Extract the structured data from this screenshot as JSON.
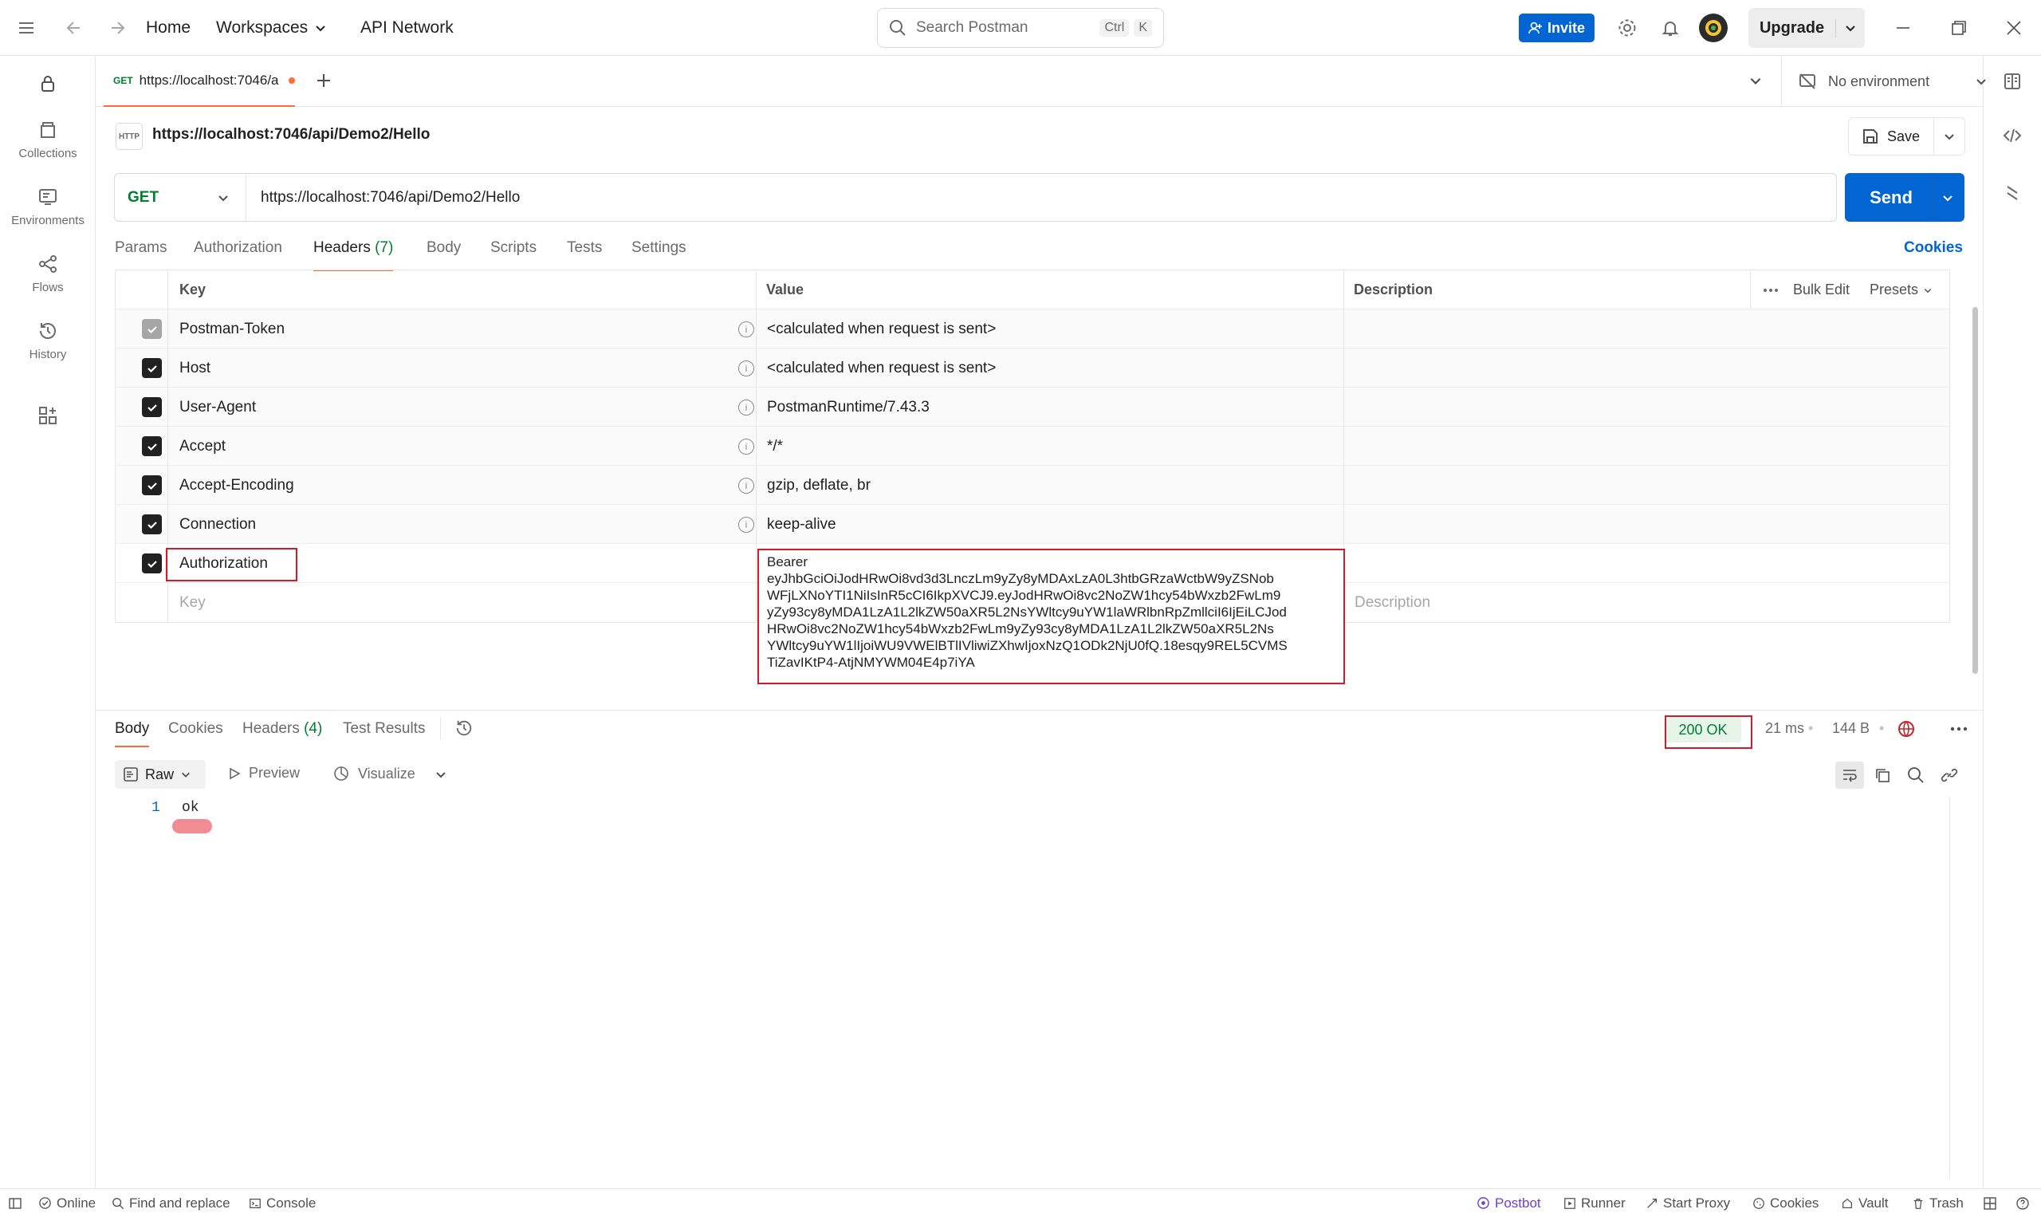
{
  "topbar": {
    "home": "Home",
    "workspaces": "Workspaces",
    "api_network": "API Network",
    "search_placeholder": "Search Postman",
    "kbd_ctrl": "Ctrl",
    "kbd_k": "K",
    "invite": "Invite",
    "upgrade": "Upgrade"
  },
  "sidebar": {
    "items": [
      {
        "label": "Collections",
        "icon": "collections-icon"
      },
      {
        "label": "Environments",
        "icon": "environments-icon"
      },
      {
        "label": "Flows",
        "icon": "flows-icon"
      },
      {
        "label": "History",
        "icon": "history-icon"
      }
    ]
  },
  "tabs": {
    "active_method": "GET",
    "active_label": "https://localhost:7046/a",
    "environment": "No environment"
  },
  "request": {
    "title": "https://localhost:7046/api/Demo2/Hello",
    "save": "Save",
    "method": "GET",
    "url": "https://localhost:7046/api/Demo2/Hello",
    "send": "Send",
    "tabs": [
      "Params",
      "Authorization",
      "Headers",
      "Body",
      "Scripts",
      "Tests",
      "Settings"
    ],
    "headers_count": "(7)",
    "cookies": "Cookies"
  },
  "headers_table": {
    "col_key": "Key",
    "col_value": "Value",
    "col_description": "Description",
    "bulk_edit": "Bulk Edit",
    "presets": "Presets",
    "rows": [
      {
        "key": "Postman-Token",
        "value": "<calculated when request is sent>",
        "checked": "disabled"
      },
      {
        "key": "Host",
        "value": "<calculated when request is sent>",
        "checked": "true"
      },
      {
        "key": "User-Agent",
        "value": "PostmanRuntime/7.43.3",
        "checked": "true"
      },
      {
        "key": "Accept",
        "value": "*/*",
        "checked": "true"
      },
      {
        "key": "Accept-Encoding",
        "value": "gzip, deflate, br",
        "checked": "true"
      },
      {
        "key": "Connection",
        "value": "keep-alive",
        "checked": "true"
      }
    ],
    "auth_key": "Authorization",
    "auth_value_lines": [
      "Bearer",
      "eyJhbGciOiJodHRwOi8vd3d3LnczLm9yZy8yMDAxLzA0L3htbGRzaWctbW9yZSNob",
      "WFjLXNoYTI1NiIsInR5cCI6IkpXVCJ9.eyJodHRwOi8vc2NoZW1hcy54bWxzb2FwLm9",
      "yZy93cy8yMDA1LzA1L2lkZW50aXR5L2NsYWltcy9uYW1laWRlbnRpZmllciI6IjEiLCJod",
      "HRwOi8vc2NoZW1hcy54bWxzb2FwLm9yZy93cy8yMDA1LzA1L2lkZW50aXR5L2Ns",
      "YWltcy9uYW1lIjoiWU9VWElBTlIVliwiZXhwIjoxNzQ1ODk2NjU0fQ.18esqy9REL5CVMS",
      "TiZavIKtP4-AtjNMYWM04E4p7iYA"
    ],
    "new_key_placeholder": "Key",
    "new_desc_placeholder": "Description"
  },
  "response": {
    "tabs": [
      "Body",
      "Cookies",
      "Headers",
      "Test Results"
    ],
    "headers_count": "(4)",
    "status": "200 OK",
    "time": "21 ms",
    "size": "144 B",
    "format": "Raw",
    "preview": "Preview",
    "visualize": "Visualize",
    "line_number": "1",
    "body_text": "ok"
  },
  "statusbar": {
    "online": "Online",
    "find_replace": "Find and replace",
    "console": "Console",
    "postbot": "Postbot",
    "runner": "Runner",
    "start_proxy": "Start Proxy",
    "cookies": "Cookies",
    "vault": "Vault",
    "trash": "Trash"
  },
  "colors": {
    "accent_blue": "#0265d2",
    "get_green": "#007f31",
    "highlight_red": "#d21c2c",
    "status_ok_bg": "#e6f4ea"
  }
}
